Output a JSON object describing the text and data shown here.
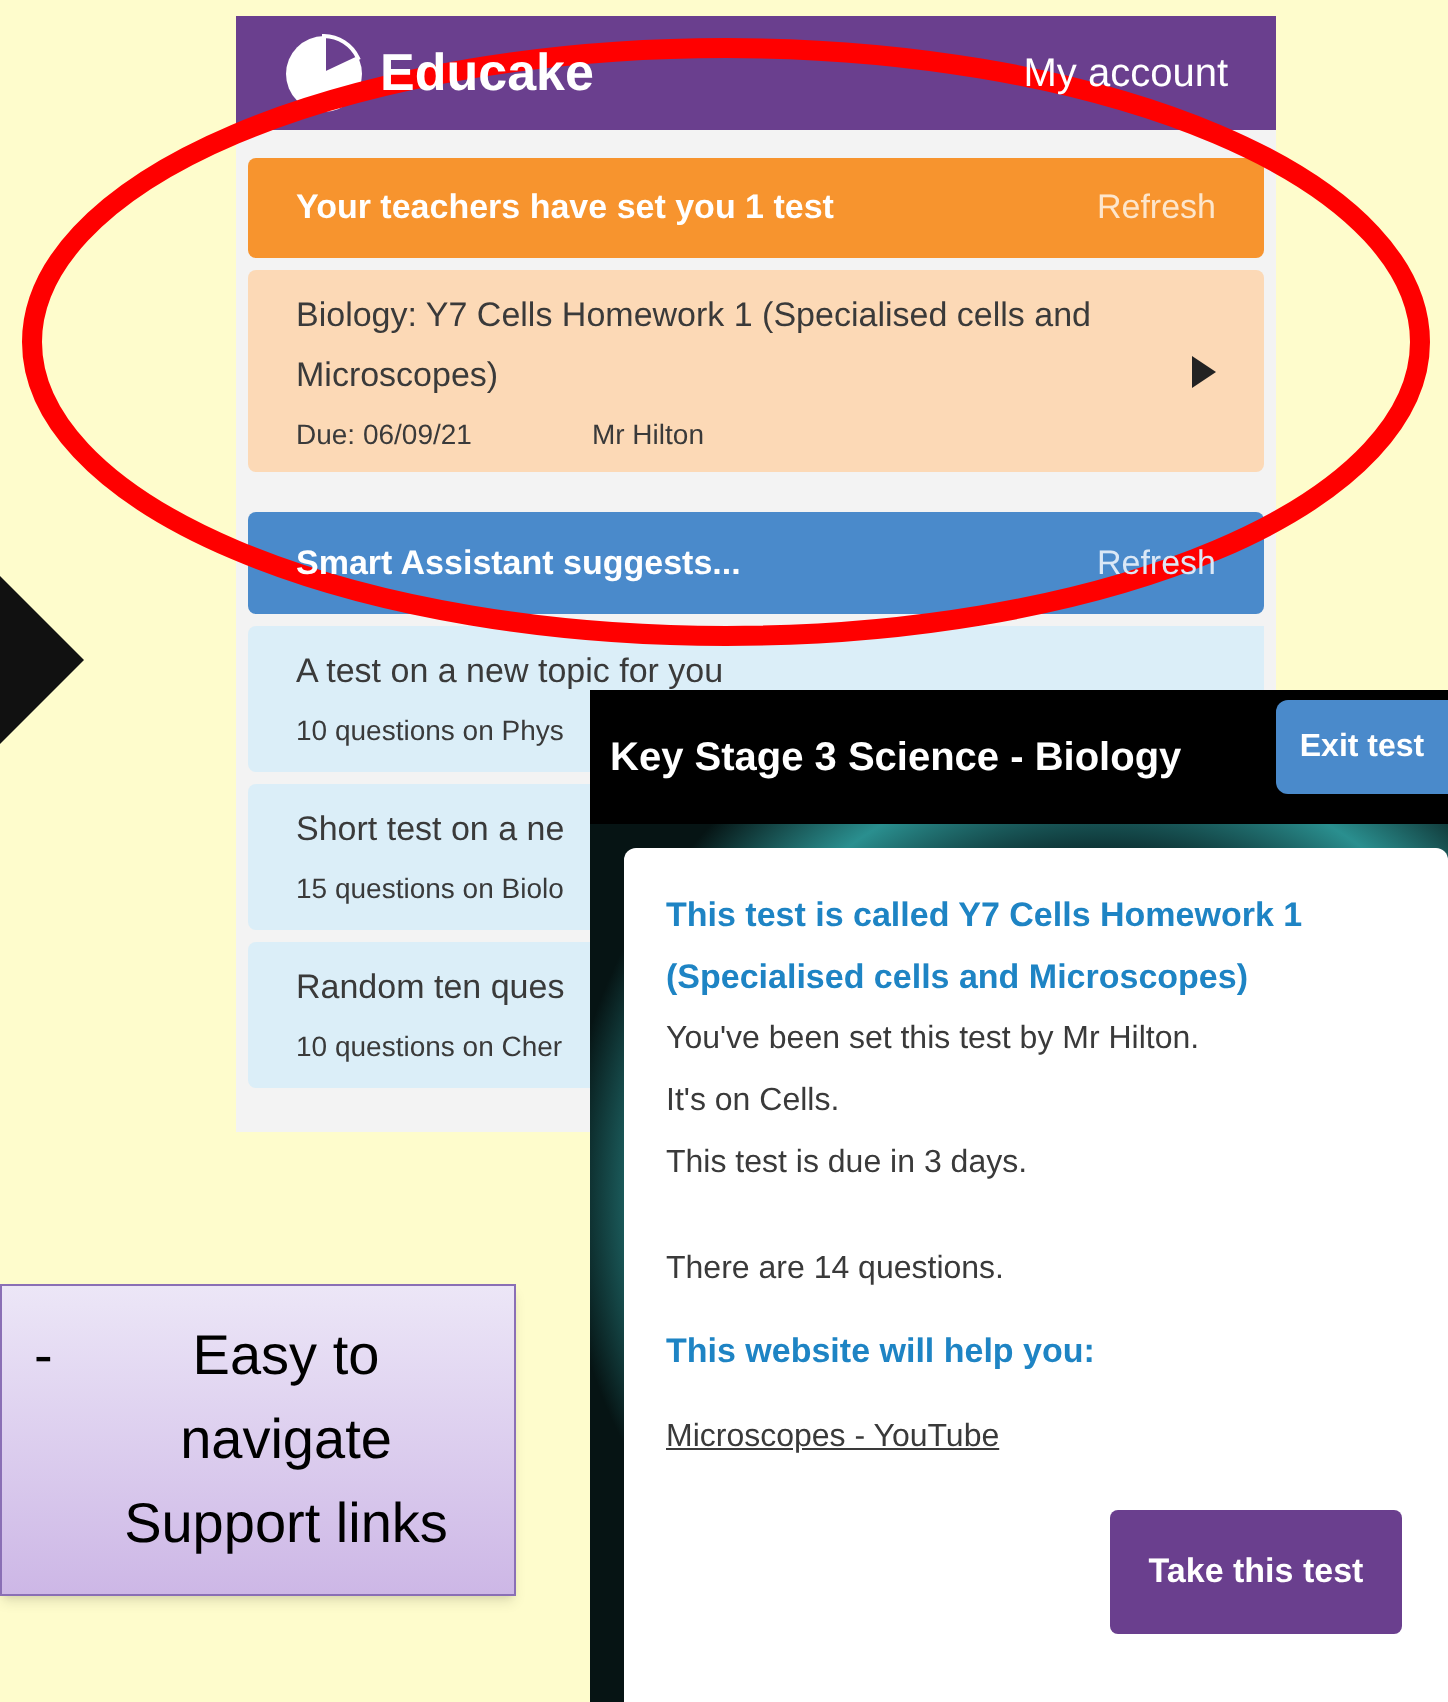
{
  "app": {
    "logo": "Educake",
    "account_link": "My account",
    "assigned": {
      "title": "Your teachers have set you 1 test",
      "refresh": "Refresh",
      "tests": [
        {
          "title": "Biology: Y7 Cells  Homework 1 (Specialised cells and Microscopes)",
          "due": "Due: 06/09/21",
          "teacher": "Mr Hilton"
        }
      ]
    },
    "suggestions": {
      "title": "Smart Assistant suggests...",
      "refresh": "Refresh",
      "items": [
        {
          "title": "A test on a new topic for you",
          "detail": "10 questions on Phys"
        },
        {
          "title": "Short test on a ne",
          "detail": "15 questions on Biolo"
        },
        {
          "title": "Random ten ques",
          "detail": "10 questions on Cher"
        }
      ]
    }
  },
  "test_dialog": {
    "title": "Key Stage 3 Science - Biology",
    "exit_button": "Exit test",
    "heading": "This test is called Y7 Cells  Homework 1 (Specialised cells and Microscopes)",
    "lines": [
      "You've been set this test by Mr Hilton.",
      "It's on Cells.",
      "This test is due in 3 days."
    ],
    "question_count": "There are 14 questions.",
    "help_heading": "This website will help you:",
    "help_link": "Microscopes - YouTube",
    "start_button": "Take this test"
  },
  "note": {
    "bullet": "-",
    "text": "Easy to navigate Support links"
  }
}
